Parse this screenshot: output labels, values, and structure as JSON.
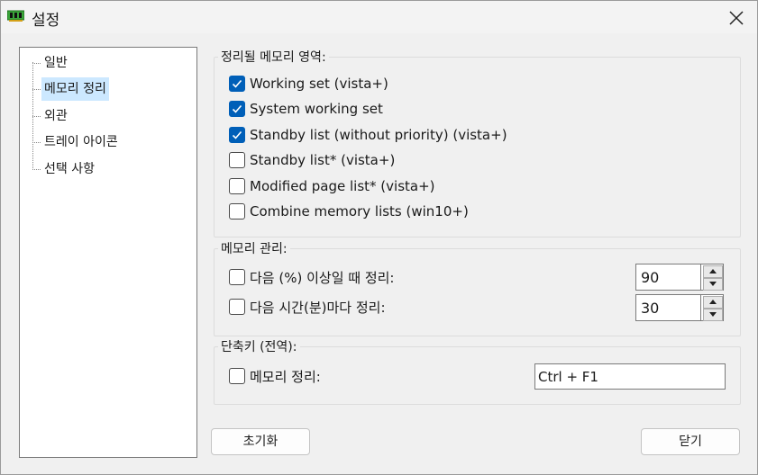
{
  "window": {
    "title": "설정"
  },
  "tree": {
    "items": [
      {
        "label": "일반",
        "selected": false
      },
      {
        "label": "메모리 정리",
        "selected": true
      },
      {
        "label": "외관",
        "selected": false
      },
      {
        "label": "트레이 아이콘",
        "selected": false
      },
      {
        "label": "선택 사항",
        "selected": false
      }
    ]
  },
  "regions": {
    "legend": "정리될 메모리 영역:",
    "options": [
      {
        "label": "Working set (vista+)",
        "checked": true
      },
      {
        "label": "System working set",
        "checked": true
      },
      {
        "label": "Standby list (without priority) (vista+)",
        "checked": true
      },
      {
        "label": "Standby list* (vista+)",
        "checked": false
      },
      {
        "label": "Modified page list* (vista+)",
        "checked": false
      },
      {
        "label": "Combine memory lists (win10+)",
        "checked": false
      }
    ]
  },
  "management": {
    "legend": "메모리 관리:",
    "percent": {
      "label": "다음 (%) 이상일 때 정리:",
      "checked": false,
      "value": "90"
    },
    "interval": {
      "label": "다음 시간(분)마다 정리:",
      "checked": false,
      "value": "30"
    }
  },
  "hotkey": {
    "legend": "단축키 (전역):",
    "label": "메모리 정리:",
    "checked": false,
    "value": "Ctrl + F1"
  },
  "buttons": {
    "reset": "초기화",
    "close": "닫기"
  },
  "colors": {
    "accent": "#005fb8",
    "selection": "#cce8ff"
  }
}
